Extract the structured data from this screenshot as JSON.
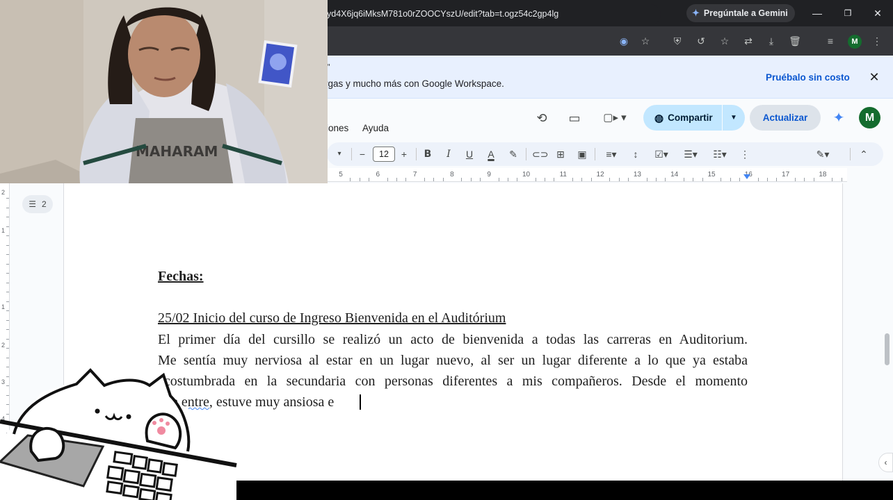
{
  "browser": {
    "gemini_button": "Pregúntale a Gemini",
    "url": "yd4X6jq6iMksM781o0rZOOCYszU/edit?tab=t.ogz54c2gp4lg",
    "profile_initial": "M"
  },
  "banner": {
    "quote_mark": "\"",
    "text": "rgas y mucho más con Google Workspace.",
    "cta": "Pruébalo sin costo"
  },
  "docs": {
    "menu": [
      "iones",
      "Ayuda"
    ],
    "share_label": "Compartir",
    "update_label": "Actualizar",
    "avatar_initial": "M",
    "font_size": "12",
    "outline_count": "2"
  },
  "ruler": {
    "numbers": [
      "5",
      "6",
      "7",
      "8",
      "9",
      "10",
      "11",
      "12",
      "13",
      "14",
      "15",
      "16",
      "17",
      "18"
    ],
    "vertical_numbers": [
      "2",
      "1",
      "1",
      "2",
      "3",
      "4"
    ]
  },
  "document": {
    "heading": "Fechas:",
    "subheading": "25/02 Inicio del curso de Ingreso Bienvenida en el Auditórium",
    "para_lines": [
      "El primer día del cursillo se realizó un acto de bienvenida a todas las carreras en Auditorium.",
      "Me sentía muy nerviosa al estar en un lugar nuevo, al ser un lugar diferente a lo que ya estaba",
      "acostumbrada en la secundaria con personas diferentes a mis compañeros. Desde el momento"
    ],
    "last_line_prefix": "que ",
    "last_line_spell": "entre",
    "last_line_rest": ", estuve muy ansiosa e"
  },
  "icons": {
    "close": "close-icon",
    "history": "history-icon",
    "comment": "comment-icon",
    "video": "video-call-icon",
    "globe": "globe-icon",
    "sparkle": "gemini-sparkle-icon"
  },
  "colors": {
    "share_bg": "#c2e7ff",
    "accent": "#0b57d0",
    "avatar": "#146c2e"
  }
}
